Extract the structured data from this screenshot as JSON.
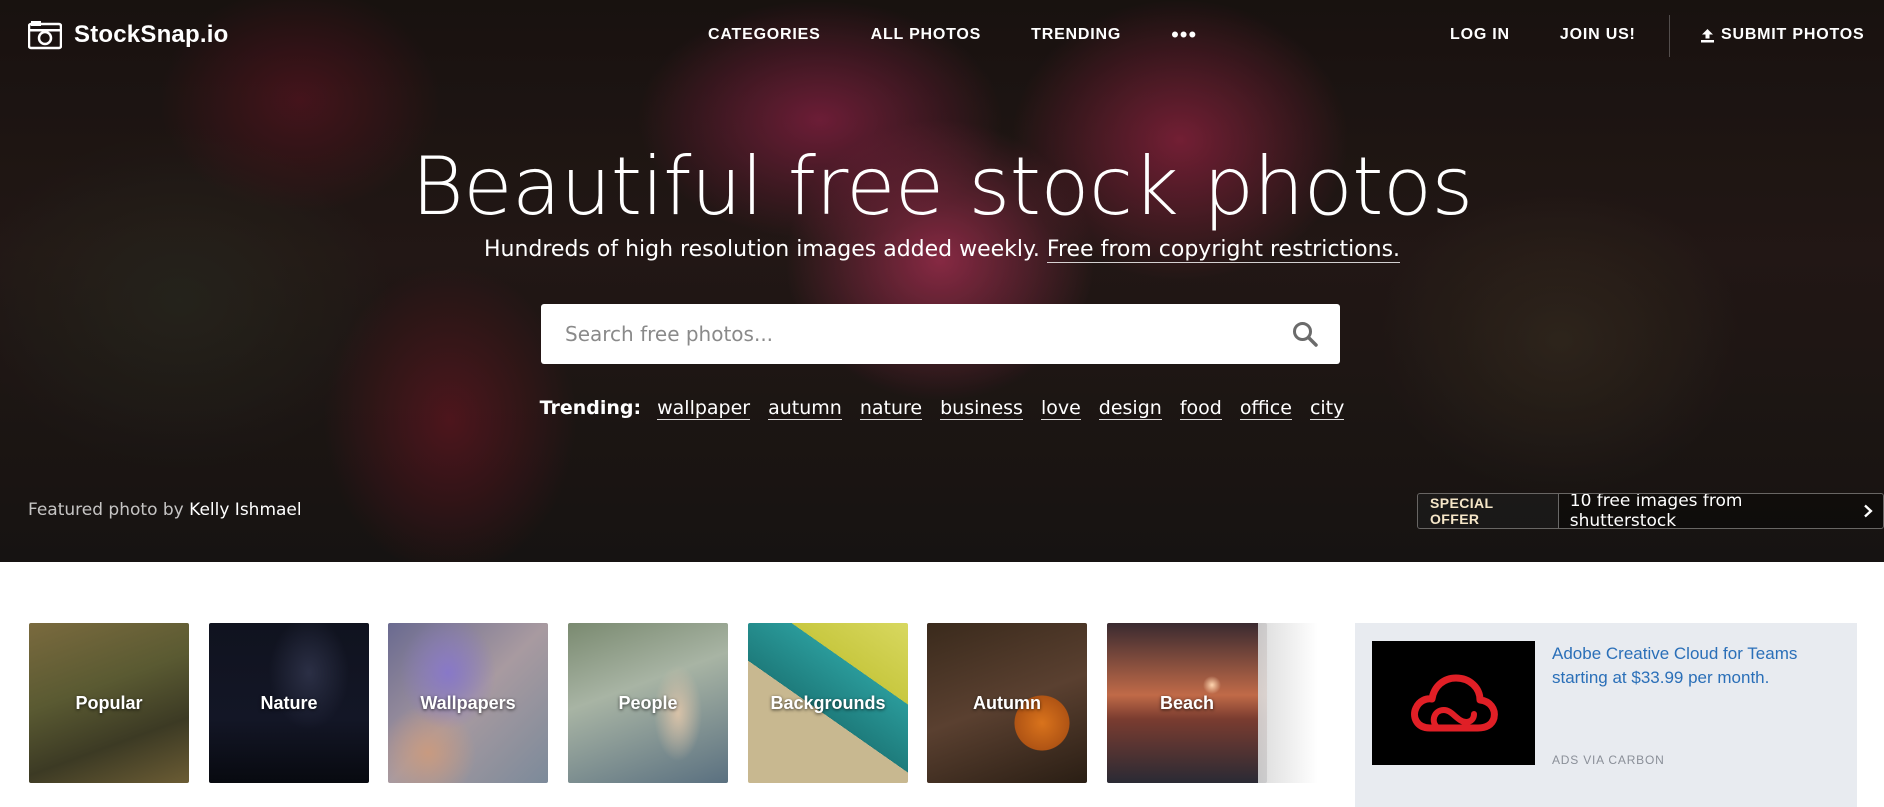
{
  "brand": {
    "name": "StockSnap.io"
  },
  "nav": {
    "categories": "CATEGORIES",
    "all_photos": "ALL PHOTOS",
    "trending": "TRENDING",
    "more": "•••",
    "log_in": "LOG IN",
    "join": "JOIN US!",
    "submit": "SUBMIT PHOTOS"
  },
  "hero": {
    "headline": "Beautiful free stock photos",
    "subhead": "Hundreds of high resolution images added weekly.",
    "subhead_link": "Free from copyright restrictions.",
    "search_placeholder": "Search free photos...",
    "trending_label": "Trending:",
    "trending_tags": [
      "wallpaper",
      "autumn",
      "nature",
      "business",
      "love",
      "design",
      "food",
      "office",
      "city"
    ],
    "featured_prefix": "Featured photo by",
    "featured_author": "Kelly Ishmael",
    "offer_badge": "SPECIAL OFFER",
    "offer_text": "10 free images from shutterstock"
  },
  "categories": [
    "Popular",
    "Nature",
    "Wallpapers",
    "People",
    "Backgrounds",
    "Autumn",
    "Beach"
  ],
  "ad": {
    "text": "Adobe Creative Cloud for Teams starting at $33.99 per month.",
    "via": "ADS VIA CARBON"
  },
  "colors": {
    "ad_link": "#2a6fb8",
    "ad_bg": "#e8ebf0",
    "offer_badge_text": "#f5e6c8"
  },
  "icons": [
    "camera-logo-icon",
    "upload-icon",
    "search-icon",
    "chevron-right-icon",
    "creative-cloud-logo"
  ]
}
